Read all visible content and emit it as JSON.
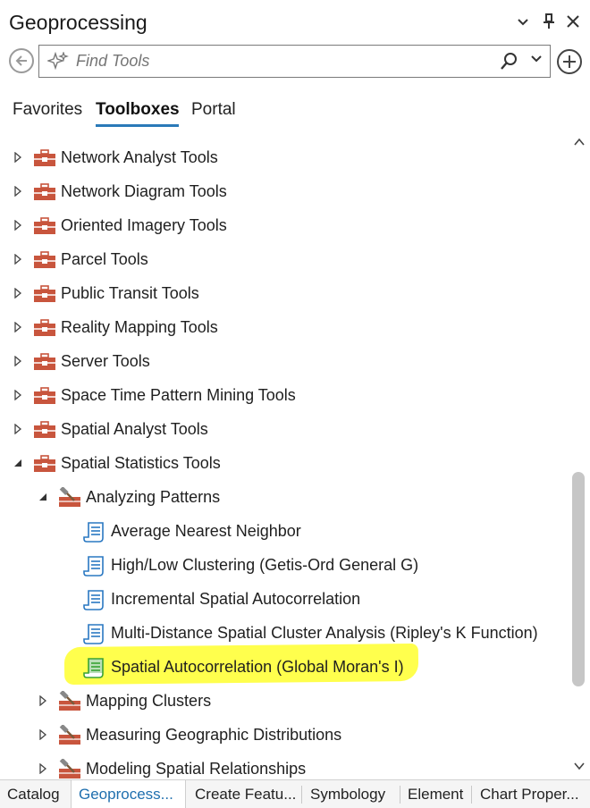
{
  "window": {
    "title": "Geoprocessing",
    "controls": [
      "chevron-down-icon",
      "pin-icon",
      "close-icon"
    ]
  },
  "search": {
    "placeholder": "Find Tools",
    "value": ""
  },
  "tabs": [
    {
      "label": "Favorites",
      "active": false
    },
    {
      "label": "Toolboxes",
      "active": true
    },
    {
      "label": "Portal",
      "active": false
    }
  ],
  "tree": {
    "items": [
      {
        "label": "Network Analyst Tools",
        "type": "toolbox",
        "expanded": false,
        "level": 0
      },
      {
        "label": "Network Diagram Tools",
        "type": "toolbox",
        "expanded": false,
        "level": 0
      },
      {
        "label": "Oriented Imagery Tools",
        "type": "toolbox",
        "expanded": false,
        "level": 0
      },
      {
        "label": "Parcel Tools",
        "type": "toolbox",
        "expanded": false,
        "level": 0
      },
      {
        "label": "Public Transit Tools",
        "type": "toolbox",
        "expanded": false,
        "level": 0
      },
      {
        "label": "Reality Mapping Tools",
        "type": "toolbox",
        "expanded": false,
        "level": 0
      },
      {
        "label": "Server Tools",
        "type": "toolbox",
        "expanded": false,
        "level": 0
      },
      {
        "label": "Space Time Pattern Mining Tools",
        "type": "toolbox",
        "expanded": false,
        "level": 0
      },
      {
        "label": "Spatial Analyst Tools",
        "type": "toolbox",
        "expanded": false,
        "level": 0
      },
      {
        "label": "Spatial Statistics Tools",
        "type": "toolbox",
        "expanded": true,
        "level": 0
      },
      {
        "label": "Analyzing Patterns",
        "type": "toolset",
        "expanded": true,
        "level": 1
      },
      {
        "label": "Average Nearest Neighbor",
        "type": "tool",
        "level": 2
      },
      {
        "label": "High/Low Clustering (Getis-Ord General G)",
        "type": "tool",
        "level": 2
      },
      {
        "label": "Incremental Spatial Autocorrelation",
        "type": "tool",
        "level": 2
      },
      {
        "label": "Multi-Distance Spatial Cluster Analysis (Ripley's K Function)",
        "type": "tool",
        "level": 2
      },
      {
        "label": "Spatial Autocorrelation (Global Moran's I)",
        "type": "tool",
        "level": 2,
        "highlighted": true
      },
      {
        "label": "Mapping Clusters",
        "type": "toolset",
        "expanded": false,
        "level": 1
      },
      {
        "label": "Measuring Geographic Distributions",
        "type": "toolset",
        "expanded": false,
        "level": 1
      },
      {
        "label": "Modeling Spatial Relationships",
        "type": "toolset",
        "expanded": false,
        "level": 1
      }
    ]
  },
  "bottom_tabs": [
    {
      "label": "Catalog",
      "active": false
    },
    {
      "label": "Geoprocess...",
      "active": true
    },
    {
      "label": "Create Featu...",
      "active": false
    },
    {
      "label": "Symbology",
      "active": false
    },
    {
      "label": "Element",
      "active": false
    },
    {
      "label": "Chart Proper...",
      "active": false
    }
  ],
  "colors": {
    "toolbox": "#c8553d",
    "tool_script": "#2a78c2",
    "tool_highlighted": "#3aa335",
    "highlight": "#ffff4d",
    "accent": "#2a7ab8"
  }
}
